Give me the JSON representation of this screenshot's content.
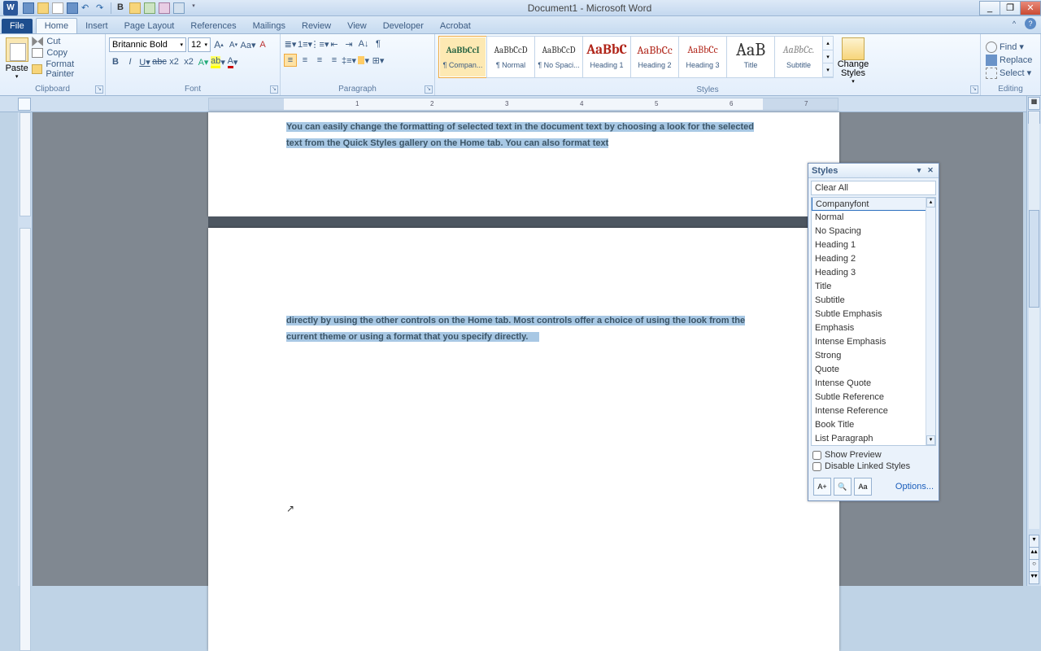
{
  "window": {
    "title": "Document1 - Microsoft Word",
    "minimize": "_",
    "maximize": "❐",
    "close": "✕"
  },
  "tabs": {
    "file": "File",
    "items": [
      "Home",
      "Insert",
      "Page Layout",
      "References",
      "Mailings",
      "Review",
      "View",
      "Developer",
      "Acrobat"
    ],
    "active": "Home"
  },
  "ribbon": {
    "clipboard": {
      "title": "Clipboard",
      "paste": "Paste",
      "cut": "Cut",
      "copy": "Copy",
      "format_painter": "Format Painter"
    },
    "font": {
      "title": "Font",
      "name": "Britannic Bold",
      "size": "12"
    },
    "paragraph": {
      "title": "Paragraph"
    },
    "styles": {
      "title": "Styles",
      "items": [
        {
          "preview": "AaBbCcI",
          "label": "¶ Compan...",
          "color": "#2b6644",
          "bold": true,
          "selected": true
        },
        {
          "preview": "AaBbCcD",
          "label": "¶ Normal",
          "color": "#333"
        },
        {
          "preview": "AaBbCcD",
          "label": "¶ No Spaci...",
          "color": "#333"
        },
        {
          "preview": "AaBbC",
          "label": "Heading 1",
          "color": "#b02418",
          "bold": true,
          "size": "17px"
        },
        {
          "preview": "AaBbCc",
          "label": "Heading 2",
          "color": "#b02418",
          "size": "14px"
        },
        {
          "preview": "AaBbCc",
          "label": "Heading 3",
          "color": "#b02418",
          "size": "12px"
        },
        {
          "preview": "AaB",
          "label": "Title",
          "color": "#333",
          "size": "22px"
        },
        {
          "preview": "AaBbCc.",
          "label": "Subtitle",
          "color": "#888",
          "italic": true,
          "size": "12px"
        }
      ],
      "change": "Change Styles"
    },
    "editing": {
      "title": "Editing",
      "find": "Find",
      "replace": "Replace",
      "select": "Select"
    }
  },
  "ruler": {
    "marks": [
      "1",
      "2",
      "3",
      "4",
      "5",
      "6",
      "7"
    ]
  },
  "document": {
    "page1_para": "You can easily change the formatting of selected text in the document text by choosing a look for the selected text from the Quick Styles gallery on the Home tab. You can also format text",
    "page2_para": "directly by using the other controls on the Home tab. Most controls offer a choice of using the look from the current theme or using a format that you specify directly."
  },
  "styles_pane": {
    "title": "Styles",
    "clear_all": "Clear All",
    "items": [
      {
        "name": "Companyfont",
        "mk": "para",
        "sel": true
      },
      {
        "name": "Normal",
        "mk": "para"
      },
      {
        "name": "No Spacing",
        "mk": "para"
      },
      {
        "name": "Heading 1",
        "mk": "link"
      },
      {
        "name": "Heading 2",
        "mk": "link"
      },
      {
        "name": "Heading 3",
        "mk": "link"
      },
      {
        "name": "Title",
        "mk": "link"
      },
      {
        "name": "Subtitle",
        "mk": "link"
      },
      {
        "name": "Subtle Emphasis",
        "mk": "char"
      },
      {
        "name": "Emphasis",
        "mk": "char"
      },
      {
        "name": "Intense Emphasis",
        "mk": "char"
      },
      {
        "name": "Strong",
        "mk": "char"
      },
      {
        "name": "Quote",
        "mk": "link"
      },
      {
        "name": "Intense Quote",
        "mk": "link"
      },
      {
        "name": "Subtle Reference",
        "mk": "char"
      },
      {
        "name": "Intense Reference",
        "mk": "char"
      },
      {
        "name": "Book Title",
        "mk": "char"
      },
      {
        "name": "List Paragraph",
        "mk": "para"
      }
    ],
    "show_preview": "Show Preview",
    "disable_linked": "Disable Linked Styles",
    "options": "Options..."
  }
}
